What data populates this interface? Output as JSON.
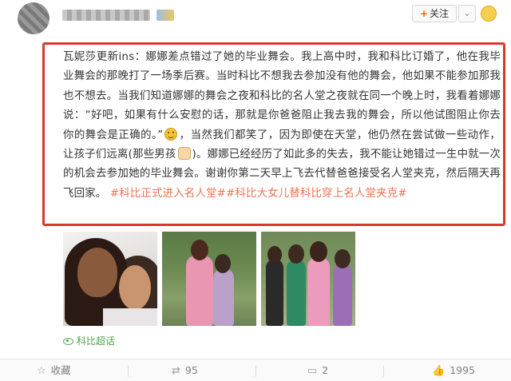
{
  "header": {
    "follow_label": "关注",
    "more_glyph": "⌄"
  },
  "post": {
    "text_lines": [
      "瓦妮莎更新ins：娜娜差点错过了她的毕业舞会。我上高中时，我和科比订婚了，",
      "他在我毕业舞会的那晚打了一场季后赛。当时科比不想我去参加没有他的舞会，",
      "他如果不能参加那我也不想去。当我们知道娜娜的舞会之夜和科比的名人堂之夜",
      "就在同一个晚上时，我看着娜娜说：“好吧，如果有什么安慰的话，那就是你爸爸",
      "阻止我去我的舞会，所以他试图阻止你去你的舞会是正确的。”",
      "，当然我们都笑",
      "了，因为即使在天堂，他仍然在尝试做一些动作，让孩子们远离(那些男孩",
      ")。",
      "娜娜已经经历了如此多的失去，我不能让她错过一生中就一次的机会去参加她的",
      "毕业舞会。谢谢你第二天早上飞去代替爸爸接受名人堂夹克，然后隔天再飞回",
      "家。"
    ],
    "hashtags": [
      "#科比正式进入名人堂#",
      "#科比大女儿替科比穿上名人堂夹克#"
    ],
    "emoji_icons": [
      "grinning-emoji",
      "cat-emoji"
    ]
  },
  "topic": {
    "label": "科比超话",
    "icon": "eye-icon"
  },
  "footer": {
    "collect_label": "收藏",
    "repost_count": "95",
    "comment_count": "2",
    "like_count": "1995"
  },
  "colors": {
    "highlight_border": "#d9372a",
    "hashtag": "#eb7350",
    "topic": "#52a24a"
  }
}
